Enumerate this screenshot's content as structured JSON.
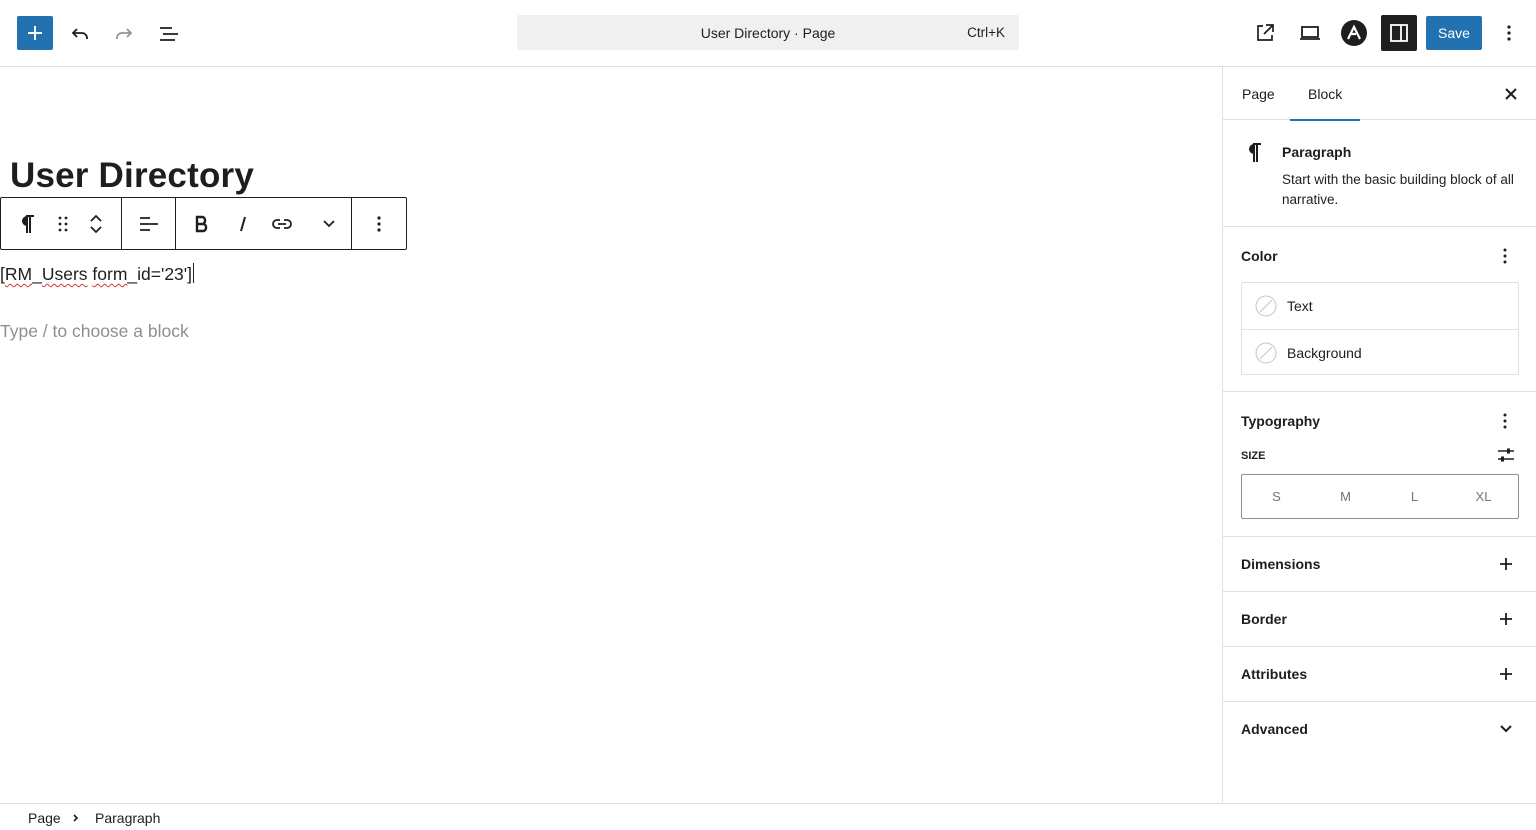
{
  "header": {
    "document_title": "User Directory · Page",
    "shortcut": "Ctrl+K",
    "save_label": "Save"
  },
  "editor": {
    "page_title": "User Directory",
    "shortcode_bracket_open": "[",
    "shortcode_word1": "RM",
    "shortcode_sep1": "_",
    "shortcode_word2": "Users",
    "shortcode_sep2": " ",
    "shortcode_word3": "form",
    "shortcode_sep3": "_",
    "shortcode_rest": "id='23']",
    "placeholder": "Type / to choose a block"
  },
  "sidebar": {
    "tabs": [
      "Page",
      "Block"
    ],
    "active_tab": "Block",
    "block": {
      "name": "Paragraph",
      "description": "Start with the basic building block of all narrative."
    },
    "color": {
      "title": "Color",
      "items": [
        "Text",
        "Background"
      ]
    },
    "typography": {
      "title": "Typography",
      "size_label": "Size",
      "size_options": [
        "S",
        "M",
        "L",
        "XL"
      ]
    },
    "panels": [
      "Dimensions",
      "Border",
      "Attributes",
      "Advanced"
    ]
  },
  "breadcrumb": [
    "Page",
    "Paragraph"
  ],
  "colors": {
    "accent": "#2271b1",
    "dark": "#1e1e1e",
    "border": "#e0e0e0",
    "muted": "#8c8f94"
  },
  "icons": {
    "add": "plus-icon",
    "undo": "undo-icon",
    "redo": "redo-icon",
    "outline": "list-view-icon",
    "view": "external-link-icon",
    "preview": "laptop-icon",
    "plugin": "astra-logo-icon",
    "settings": "sidebar-icon",
    "options": "kebab-icon"
  }
}
